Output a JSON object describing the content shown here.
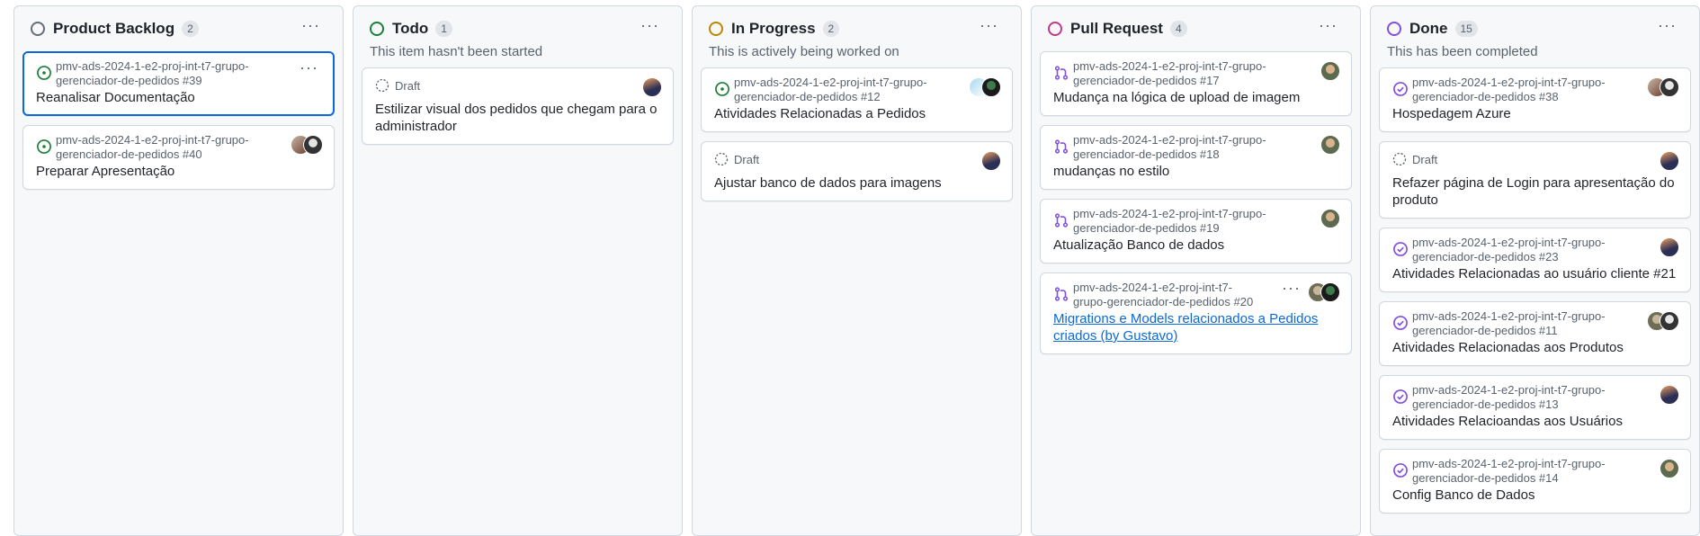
{
  "columns": [
    {
      "title": "Product Backlog",
      "count": "2",
      "description": "",
      "color": "#656d76",
      "menu": "···",
      "cards": [
        {
          "meta": "pmv-ads-2024-1-e2-proj-int-t7-grupo-gerenciador-de-pedidos #39",
          "title": "Reanalisar Documentação",
          "icon": "issue-open-icon"
        },
        {
          "meta": "pmv-ads-2024-1-e2-proj-int-t7-grupo-gerenciador-de-pedidos #40",
          "title": "Preparar Apresentação",
          "icon": "issue-open-icon"
        }
      ]
    },
    {
      "title": "Todo",
      "count": "1",
      "description": "This item hasn't been started",
      "color": "#1a7f37",
      "menu": "···",
      "cards": [
        {
          "draft_label": "Draft",
          "title": "Estilizar visual dos pedidos que chegam para o administrador",
          "icon": "draft-icon"
        }
      ]
    },
    {
      "title": "In Progress",
      "count": "2",
      "description": "This is actively being worked on",
      "color": "#bf8700",
      "menu": "···",
      "cards": [
        {
          "meta": "pmv-ads-2024-1-e2-proj-int-t7-grupo-gerenciador-de-pedidos #12",
          "title": "Atividades Relacionadas a Pedidos",
          "icon": "issue-open-icon"
        },
        {
          "draft_label": "Draft",
          "title": "Ajustar banco de dados para imagens",
          "icon": "draft-icon"
        }
      ]
    },
    {
      "title": "Pull Request",
      "count": "4",
      "description": "",
      "color": "#bf3989",
      "menu": "···",
      "cards": [
        {
          "meta": "pmv-ads-2024-1-e2-proj-int-t7-grupo-gerenciador-de-pedidos #17",
          "title": "Mudança na lógica de upload de imagem",
          "icon": "pull-request-icon"
        },
        {
          "meta": "pmv-ads-2024-1-e2-proj-int-t7-grupo-gerenciador-de-pedidos #18",
          "title": "mudanças no estilo",
          "icon": "pull-request-icon"
        },
        {
          "meta": "pmv-ads-2024-1-e2-proj-int-t7-grupo-gerenciador-de-pedidos #19",
          "title": "Atualização Banco de dados",
          "icon": "pull-request-icon"
        },
        {
          "meta": "pmv-ads-2024-1-e2-proj-int-t7-grupo-gerenciador-de-pedidos #20",
          "title": "Migrations e Models relacionados a Pedidos criados (by Gustavo)",
          "icon": "pull-request-icon",
          "link": true
        }
      ]
    },
    {
      "title": "Done",
      "count": "15",
      "description": "This has been completed",
      "color": "#8250df",
      "menu": "···",
      "cards": [
        {
          "meta": "pmv-ads-2024-1-e2-proj-int-t7-grupo-gerenciador-de-pedidos #38",
          "title": "Hospedagem Azure",
          "icon": "issue-closed-icon"
        },
        {
          "draft_label": "Draft",
          "title": "Refazer página de Login para apresentação do produto",
          "icon": "draft-icon"
        },
        {
          "meta": "pmv-ads-2024-1-e2-proj-int-t7-grupo-gerenciador-de-pedidos #23",
          "title": "Atividades Relacionadas ao usuário cliente #21",
          "icon": "issue-closed-icon"
        },
        {
          "meta": "pmv-ads-2024-1-e2-proj-int-t7-grupo-gerenciador-de-pedidos #11",
          "title": "Atividades Relacionadas aos Produtos",
          "icon": "issue-closed-icon"
        },
        {
          "meta": "pmv-ads-2024-1-e2-proj-int-t7-grupo-gerenciador-de-pedidos #13",
          "title": "Atividades Relacioandas aos Usuários",
          "icon": "issue-closed-icon"
        },
        {
          "meta": "pmv-ads-2024-1-e2-proj-int-t7-grupo-gerenciador-de-pedidos #14",
          "title": "Config Banco de Dados",
          "icon": "issue-closed-icon"
        }
      ]
    }
  ],
  "card_menu": "···"
}
